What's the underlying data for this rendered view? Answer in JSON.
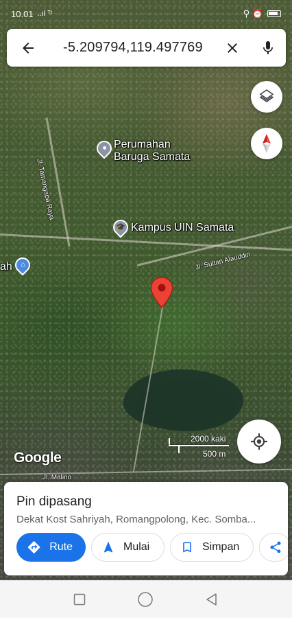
{
  "status": {
    "time": "10.01",
    "signal": "..ıl ᵀᵗ",
    "right_icons": "⚲ ⏰"
  },
  "search": {
    "query": "-5.209794,119.497769"
  },
  "map": {
    "places": [
      {
        "name": "Perumahan",
        "name2": "Baruga Samata"
      },
      {
        "name": "Kampus UIN Samata"
      },
      {
        "name": "ah"
      }
    ],
    "streets": [
      "Jl. Tamangapa Raya",
      "Jl. Sultan Alauddin",
      "Jl. Malino"
    ],
    "attribution": "Google",
    "scale": {
      "imperial": "2000 kaki",
      "metric": "500 m"
    }
  },
  "card": {
    "title": "Pin dipasang",
    "subtitle": "Dekat Kost Sahriyah, Romangpolong, Kec. Somba...",
    "actions": {
      "route": "Rute",
      "start": "Mulai",
      "save": "Simpan"
    }
  },
  "colors": {
    "accent": "#1a73e8",
    "pin": "#ea4335",
    "poi_blue": "#4a8ae0"
  }
}
